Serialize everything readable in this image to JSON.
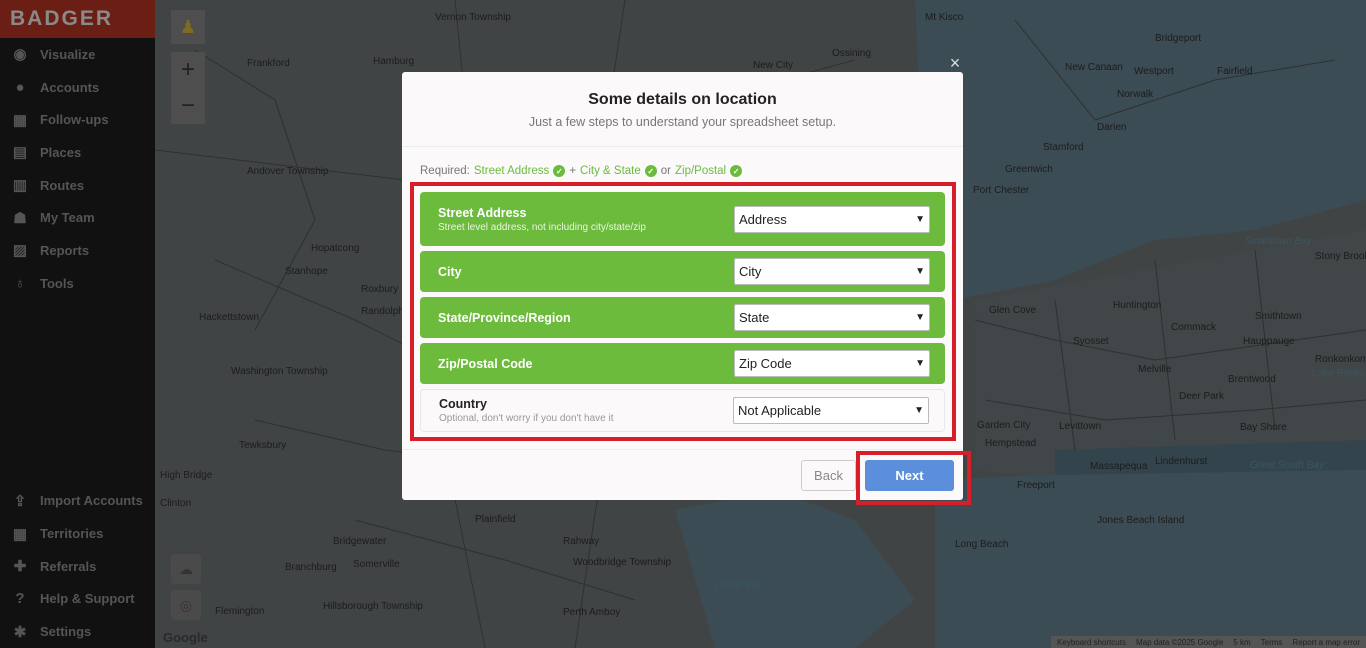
{
  "app": {
    "logo": "BADGER"
  },
  "sidebar": {
    "items": [
      {
        "label": "Visualize",
        "icon": "eye-icon",
        "glyph": "◉"
      },
      {
        "label": "Accounts",
        "icon": "user-icon",
        "glyph": "●"
      },
      {
        "label": "Follow-ups",
        "icon": "calendar-icon",
        "glyph": "▦"
      },
      {
        "label": "Places",
        "icon": "store-icon",
        "glyph": "▤"
      },
      {
        "label": "Routes",
        "icon": "map-icon",
        "glyph": "▥"
      },
      {
        "label": "My Team",
        "icon": "team-icon",
        "glyph": "☗"
      },
      {
        "label": "Reports",
        "icon": "report-icon",
        "glyph": "▨"
      },
      {
        "label": "Tools",
        "icon": "lightbulb-icon",
        "glyph": "♁"
      }
    ],
    "bottom_items": [
      {
        "label": "Import Accounts",
        "icon": "upload-icon",
        "glyph": "⇪"
      },
      {
        "label": "Territories",
        "icon": "territories-icon",
        "glyph": "▦"
      },
      {
        "label": "Referrals",
        "icon": "gift-icon",
        "glyph": "✚"
      },
      {
        "label": "Help & Support",
        "icon": "help-icon",
        "glyph": "?"
      },
      {
        "label": "Settings",
        "icon": "gear-icon",
        "glyph": "✱"
      }
    ]
  },
  "map": {
    "labels": [
      "Vernon Township",
      "Frankford",
      "Hamburg",
      "Mt Kisco",
      "Bridgeport",
      "New City",
      "Ossining",
      "New Canaan",
      "Westport",
      "Fairfield",
      "Norwalk",
      "Darien",
      "Stamford",
      "Port Chester",
      "Greenwich",
      "Hopatcong",
      "Stanhope",
      "Hackettstown",
      "Washington Township",
      "Tewksbury",
      "High Bridge",
      "Clinton",
      "Andover Township",
      "Huntington",
      "Smithtown",
      "Stony Brook",
      "Commack",
      "Hauppauge",
      "Ronkonkoma",
      "Glen Cove",
      "Syosset",
      "Melville",
      "Deer Park",
      "Brentwood",
      "Garden City",
      "Hempstead",
      "Levittown",
      "Bay Shore",
      "Massapequa",
      "Lindenhurst",
      "Freeport",
      "Jones Beach Island",
      "Long Beach",
      "Bridgewater",
      "Branchburg",
      "Somerville",
      "Plainfield",
      "Rahway",
      "Woodbridge Township",
      "Perth Amboy",
      "Hillsborough Township",
      "Flemington",
      "Randolph",
      "Roxbury",
      "Ronkonkoma"
    ],
    "water_labels": [
      "Smithtown Bay",
      "Great South Bay",
      "Lake Ronkonkoma",
      "Lower Bay"
    ],
    "zoom_in": "+",
    "zoom_out": "−",
    "google": "Google",
    "attribution": [
      "Keyboard shortcuts",
      "Map data ©2025 Google",
      "5 km",
      "Terms",
      "Report a map error"
    ]
  },
  "modal": {
    "close": "×",
    "title": "Some details on location",
    "subtitle": "Just a few steps to understand your spreadsheet setup.",
    "required_prefix": "Required:",
    "req_street": "Street Address",
    "req_plus": "+",
    "req_city_state": "City & State",
    "req_or": "or",
    "req_zip": "Zip/Postal",
    "fields": [
      {
        "label": "Street Address",
        "desc": "Street level address, not including city/state/zip",
        "value": "Address"
      },
      {
        "label": "City",
        "desc": "",
        "value": "City"
      },
      {
        "label": "State/Province/Region",
        "desc": "",
        "value": "State"
      },
      {
        "label": "Zip/Postal Code",
        "desc": "",
        "value": "Zip Code"
      },
      {
        "label": "Country",
        "desc": "Optional, don't worry if you don't have it",
        "value": "Not Applicable"
      }
    ],
    "back": "Back",
    "next": "Next"
  },
  "colors": {
    "green": "#6cbb3d",
    "next_blue": "#5b8fdb",
    "highlight": "#d61f28"
  }
}
